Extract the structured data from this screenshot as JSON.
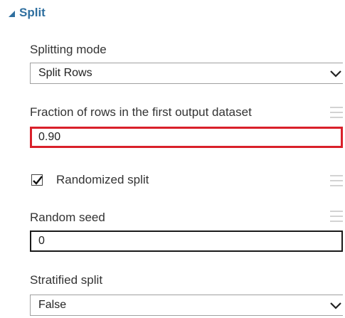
{
  "section": {
    "title": "Split",
    "toggle_icon": "collapse-triangle-icon"
  },
  "splitting_mode": {
    "label": "Splitting mode",
    "value": "Split Rows"
  },
  "fraction": {
    "label": "Fraction of rows in the first output dataset",
    "value": "0.90"
  },
  "randomized": {
    "label": "Randomized split",
    "checked": true
  },
  "random_seed": {
    "label": "Random seed",
    "value": "0"
  },
  "stratified": {
    "label": "Stratified split",
    "value": "False"
  },
  "icons": {
    "handle": "drag-handle-icon",
    "dropdown": "chevron-down-icon",
    "check": "checkmark-icon"
  },
  "colors": {
    "section_accent": "#2f6f9f",
    "error_border": "#d9202a",
    "handle": "#d3d3d3"
  }
}
